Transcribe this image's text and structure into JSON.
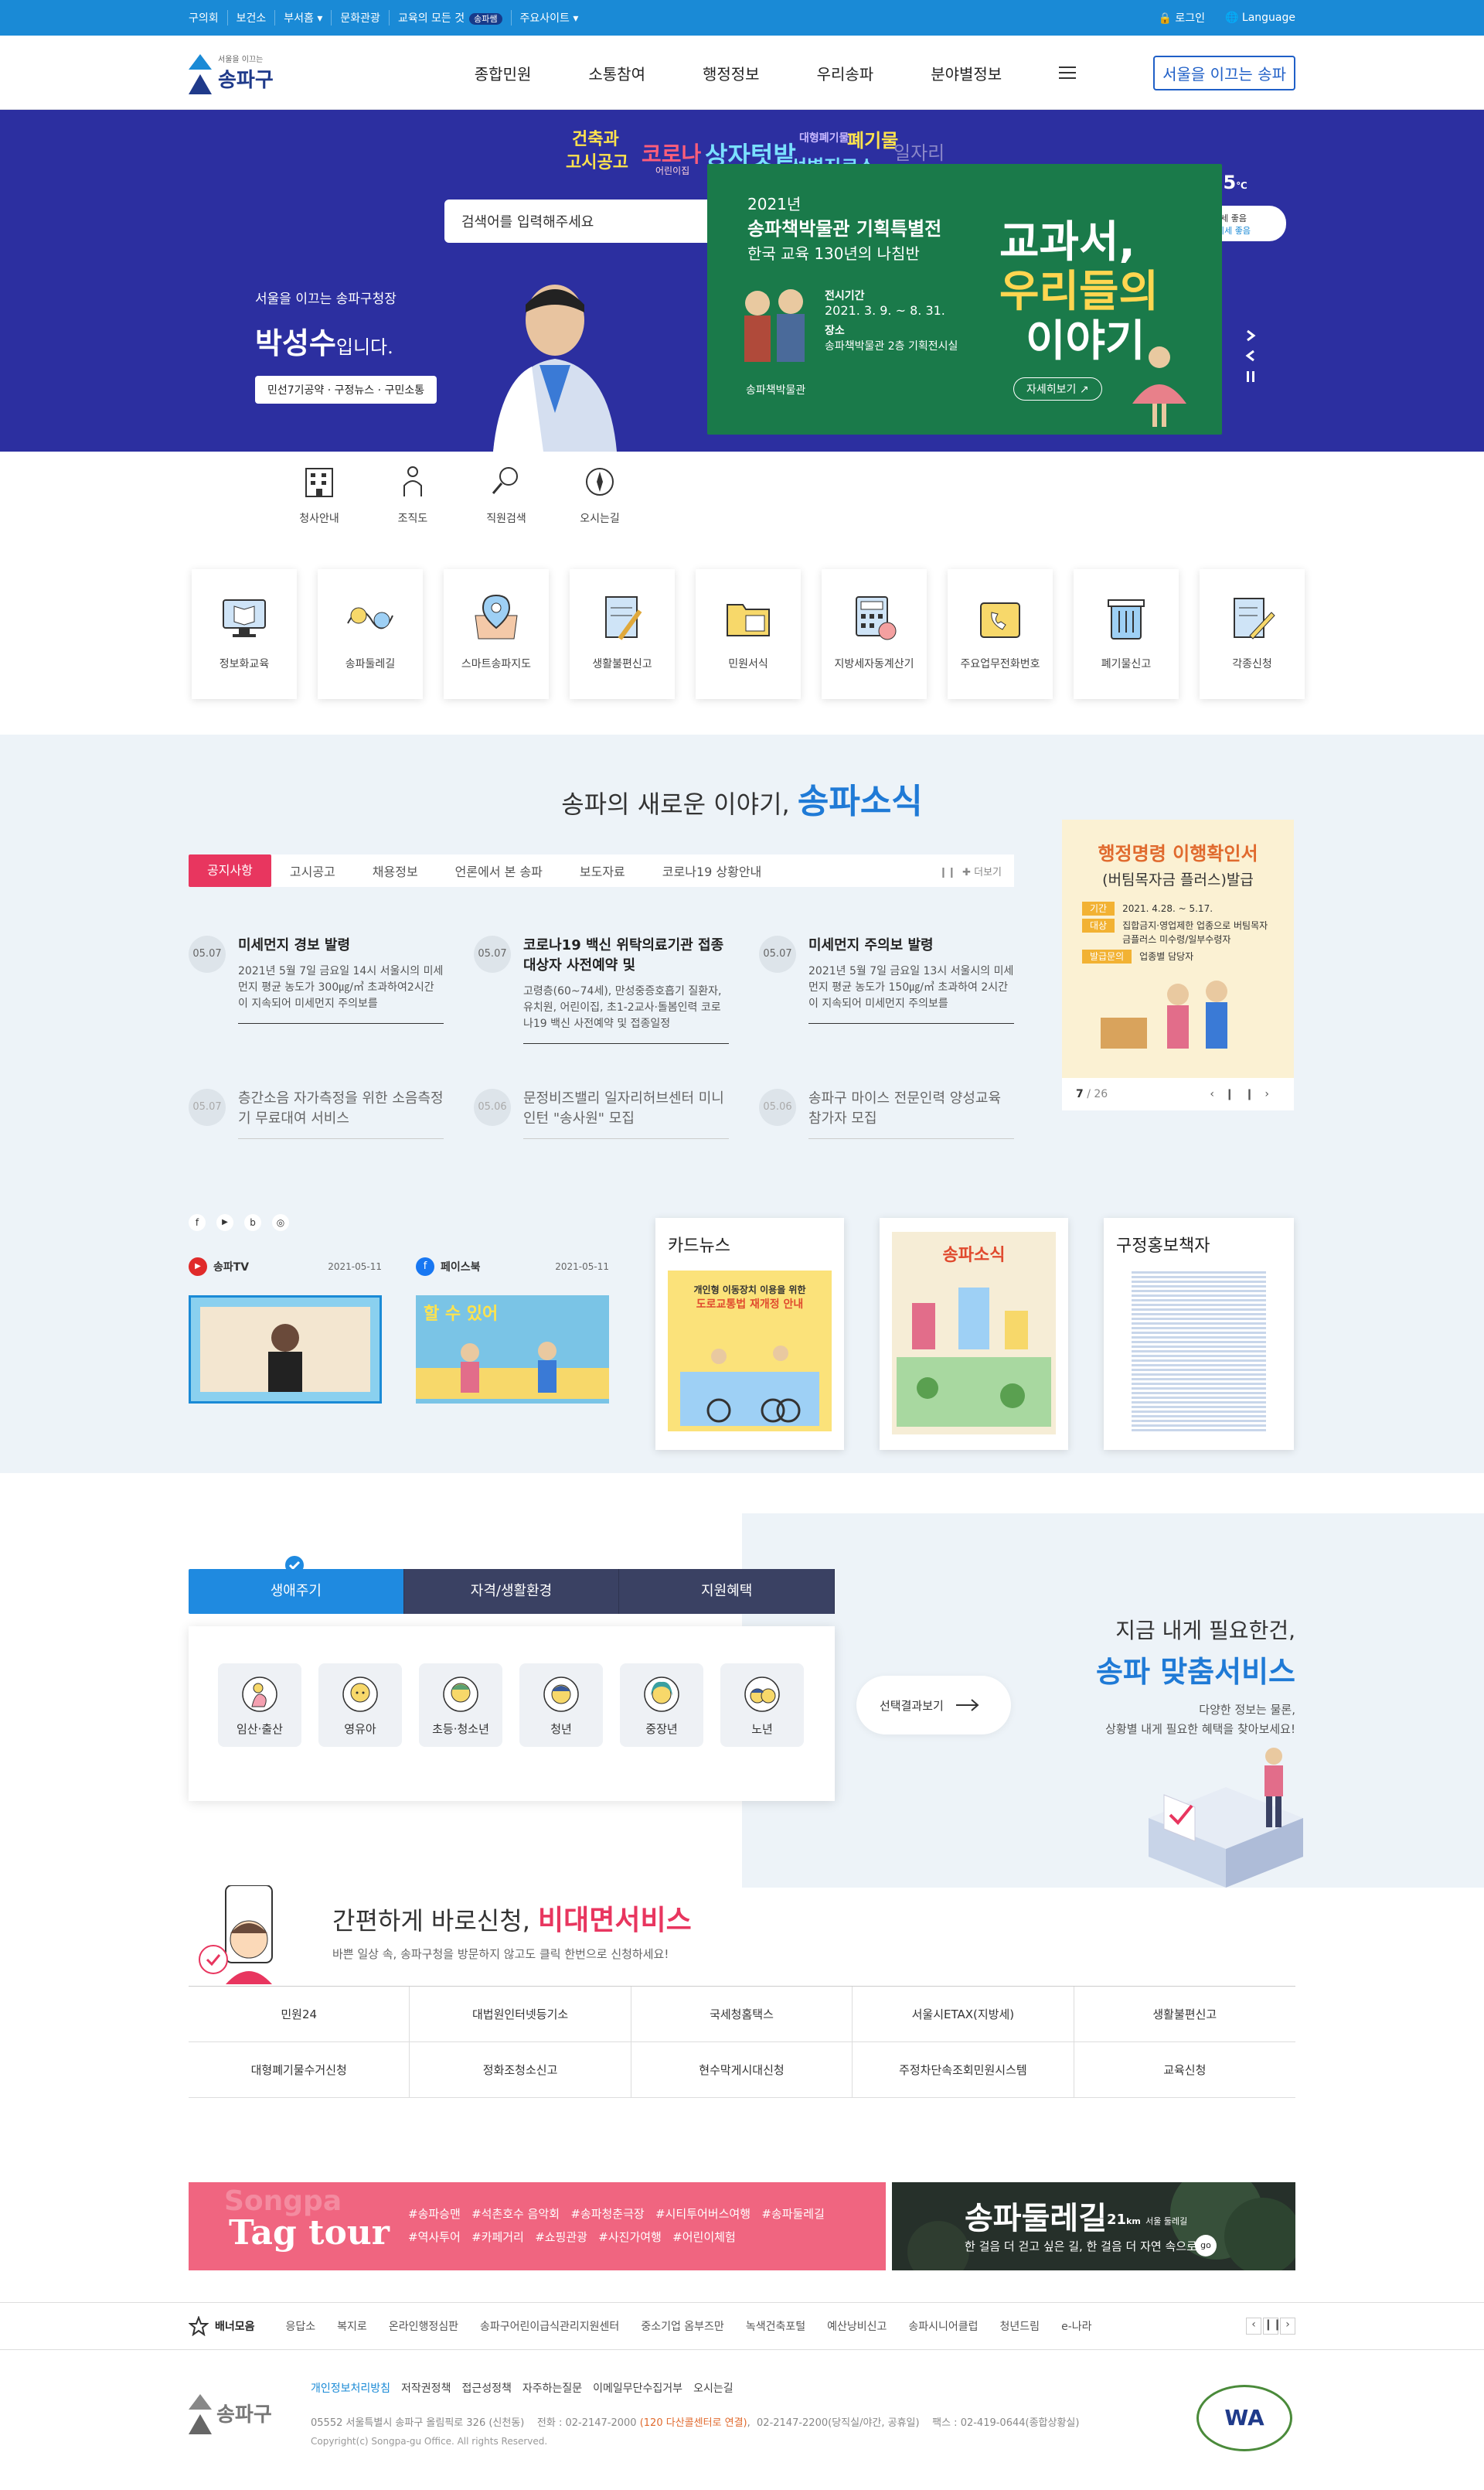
{
  "util": {
    "links": [
      "구의회",
      "보건소",
      "부서홈",
      "문화관광",
      "교육의 모든 것"
    ],
    "badge": "송파쌤",
    "site": "주요사이트",
    "login": "로그인",
    "language": "Language"
  },
  "header": {
    "logo_sub": "서울을 이끄는",
    "logo_name": "송파구",
    "nav": [
      "종합민원",
      "소통참여",
      "행정정보",
      "우리송파",
      "분야별정보"
    ],
    "slogan": "서울을 이끄는 송파"
  },
  "hero": {
    "keywords": [
      "건축과",
      "고시공고",
      "코로나",
      "어린이집",
      "상자텃밭",
      "대형폐기물",
      "폐기물",
      "선별진료소",
      "일자리"
    ],
    "search_placeholder": "검색어를 입력해주세요",
    "temp": "25.5",
    "temp_unit": "℃",
    "dust1": "미세 좋음",
    "dust2": "초미세 좋음",
    "mayor_intro": "서울을 이끄는 송파구청장",
    "mayor_name": "박성수",
    "mayor_suffix": "입니다.",
    "mayor_links": [
      "민선7기공약",
      "구정뉴스",
      "구민소통"
    ]
  },
  "banner": {
    "year": "2021년",
    "title1": "송파책박물관 기획특별전",
    "title2": "한국 교육 130년의 나침반",
    "big1": "교과서,",
    "big2": "우리들의",
    "big3": "이야기",
    "period_label": "전시기간",
    "period": "2021. 3. 9. ~ 8. 31.",
    "place_label": "장소",
    "place": "송파책박물관 2층 기획전시실",
    "org": "송파책박물관",
    "more": "자세히보기"
  },
  "quick": [
    "청사안내",
    "조직도",
    "직원검색",
    "오시는길"
  ],
  "services": [
    "정보화교육",
    "송파둘레길",
    "스마트송파지도",
    "생활불편신고",
    "민원서식",
    "지방세자동계산기",
    "주요업무전화번호",
    "폐기물신고",
    "각종신청"
  ],
  "news": {
    "title_pre": "송파의 새로운 이야기,",
    "title_main": "송파소식",
    "tabs": [
      "공지사항",
      "고시공고",
      "채용정보",
      "언론에서 본 송파",
      "보도자료",
      "코로나19 상황안내"
    ],
    "more": "더보기",
    "items": [
      {
        "date": "05.07",
        "title": "미세먼지 경보 발령",
        "body": "2021년 5월 7일 금요일 14시 서울시의 미세먼지 평균 농도가 300㎍/㎥ 초과하여2시간이 지속되어 미세먼지 주의보를"
      },
      {
        "date": "05.07",
        "title": "코로나19 백신 위탁의료기관 접종대상자 사전예약 및",
        "body": "고령층(60~74세), 만성중증호흡기 질환자, 유치원, 어린이집, 초1-2교사·돌봄인력 코로나19 백신 사전예약 및 접종일정"
      },
      {
        "date": "05.07",
        "title": "미세먼지 주의보 발령",
        "body": "2021년 5월 7일 금요일 13시 서울시의 미세먼지 평균 농도가 150㎍/㎥ 초과하여 2시간이 지속되어 미세먼지 주의보를"
      },
      {
        "date": "05.07",
        "title": "층간소음 자가측정을 위한 소음측정기 무료대여 서비스"
      },
      {
        "date": "05.06",
        "title": "문정비즈밸리 일자리허브센터 미니인턴 \"송사원\" 모집"
      },
      {
        "date": "05.06",
        "title": "송파구 마이스 전문인력 양성교육 참가자 모집"
      }
    ],
    "promo_title": "행정명령 이행확인서",
    "promo_sub": "(버팀목자금 플러스)발급",
    "promo_rows": [
      [
        "기간",
        "2021. 4.28. ~ 5.17."
      ],
      [
        "대상",
        "집합금지·영업제한 업종으로 버팀목자금플러스 미수령/일부수령자"
      ],
      [
        "발급문의",
        "업종별 담당자"
      ]
    ],
    "promo_page": "7",
    "promo_total": "/ 26",
    "tv": "송파TV",
    "tv_date": "2021-05-11",
    "fb": "페이스북",
    "fb_date": "2021-05-11",
    "card_news": "카드뉴스",
    "promo_book": "구정홍보책자",
    "cardnews_text1": "개인형 이동장치 이용을 위한",
    "cardnews_text2": "도로교통법 재개정 안내",
    "songpa_news": "송파소식",
    "fb_text": "할 수 있어"
  },
  "life": {
    "tabs": [
      "생애주기",
      "자격/생활환경",
      "지원혜택"
    ],
    "items": [
      "임산·출산",
      "영유아",
      "초등·청소년",
      "청년",
      "중장년",
      "노년"
    ],
    "result": "선택결과보기",
    "h1": "지금 내게 필요한건,",
    "h2": "송파 맞춤서비스",
    "desc1": "다양한 정보는 물론,",
    "desc2": "상황별 내게 필요한 혜택을 찾아보세요!"
  },
  "contactless": {
    "pre": "간편하게 바로신청,",
    "main": "비대면서비스",
    "desc": "바쁜 일상 속, 송파구청을 방문하지 않고도 클릭 한번으로 신청하세요!",
    "items": [
      "민원24",
      "대법원인터넷등기소",
      "국세청홈택스",
      "서울시ETAX(지방세)",
      "생활불편신고",
      "대형폐기물수거신청",
      "정화조청소신고",
      "현수막게시대신청",
      "주정차단속조회민원시스템",
      "교육신청"
    ]
  },
  "tagtour": {
    "bg": "Songpa",
    "title": "Tag tour",
    "tags": [
      "#송파승맨",
      "#석촌호수 음악회",
      "#송파청춘극장",
      "#시티투어버스여행",
      "#송파둘레길",
      "#역사투어",
      "#카페거리",
      "#쇼핑관광",
      "#사진가여행",
      "#어린이체험"
    ]
  },
  "dulle": {
    "title": "송파둘레길",
    "km": "21",
    "km_unit": "km",
    "sub": "서울 둘레길",
    "desc1": "한 걸음 더 걷고 싶은 길, 한 걸음 더 자연 속으로",
    "go": "go"
  },
  "bannerbar": {
    "label": "배너모음",
    "items": [
      "응답소",
      "복지로",
      "온라인행정심판",
      "송파구어린이급식관리지원센터",
      "중소기업 옴부즈만",
      "녹색건축포털",
      "예산낭비신고",
      "송파시니어클럽",
      "청년드림",
      "e-나라"
    ]
  },
  "footer": {
    "links": [
      "개인정보처리방침",
      "저작권정책",
      "접근성정책",
      "자주하는질문",
      "이메일무단수집거부",
      "오시는길"
    ],
    "addr": "05552 서울특별시 송파구 올림픽로 326 (신천동)",
    "tel_label": "전화 :",
    "tel": "02-2147-2000",
    "tel_center": "(120 다산콜센터로 연결)",
    "tel2": "02-2147-2200(당직실/야간, 공휴일)",
    "fax": "팩스 : 02-419-0644(종합상황실)",
    "copy": "Copyright(c) Songpa-gu Office. All rights Reserved.",
    "wa": "WA"
  },
  "colors": {
    "primary": "#1a8ad6",
    "hero": "#2c2fa0",
    "accent": "#e8365f",
    "navy": "#1f3a8a"
  }
}
